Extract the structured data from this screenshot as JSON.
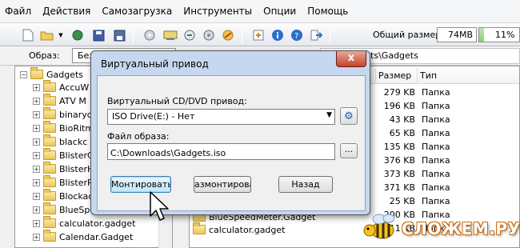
{
  "menu": [
    "Файл",
    "Действия",
    "Самозагрузка",
    "Инструменты",
    "Опции",
    "Помощь"
  ],
  "toolbar": {
    "size_label": "Общий размер:",
    "size_value": "74MB",
    "size_percent_text": "11%",
    "size_percent": 11
  },
  "image_row": {
    "label": "Образ:",
    "field_text": "Без загрузочного",
    "tab_text": "cts\\Gadgets"
  },
  "tree": {
    "root": "Gadgets",
    "items": [
      "AccuW",
      "ATV M",
      "binaryc",
      "BioRitm",
      "blackc",
      "BlisterC",
      "BlisterH",
      "BlisterR",
      "Blockad",
      "BlueSp",
      "calculator.gadget",
      "Calendar.Gadget"
    ]
  },
  "filelist": {
    "col_size": "Размер",
    "col_type": "Тип",
    "rows": [
      {
        "size": "279 KB",
        "type": "Папка"
      },
      {
        "size": "196 KB",
        "type": "Папка"
      },
      {
        "size": "43 KB",
        "type": "Папка"
      },
      {
        "size": "65 KB",
        "type": "Папка"
      },
      {
        "size": "135 KB",
        "type": "Папка"
      },
      {
        "size": "376 KB",
        "type": "Папка"
      },
      {
        "size": "373 KB",
        "type": "Папка"
      },
      {
        "size": "371 KB",
        "type": "Папка"
      },
      {
        "size": "25 KB",
        "type": "Папка"
      },
      {
        "size": "200 KB",
        "type": "Папка"
      },
      {
        "size": "11 KB",
        "type": "Папка"
      }
    ],
    "visible_names": [
      "BlueSpeedMeter.Gadget",
      "calculator.gadget"
    ]
  },
  "dialog": {
    "title": "Виртуальный привод",
    "close": "x",
    "drive_label": "Виртуальный CD/DVD привод:",
    "drive_value": "ISO Drive(E:) - Нет",
    "file_label": "Файл образа:",
    "file_value": "C:\\Downloads\\Gadgets.iso",
    "browse": "...",
    "mount": "Монтировать",
    "unmount": "азмонтирова",
    "back": "Назад"
  },
  "watermark": {
    "text": "СЛОЖЕМ.РУ"
  }
}
